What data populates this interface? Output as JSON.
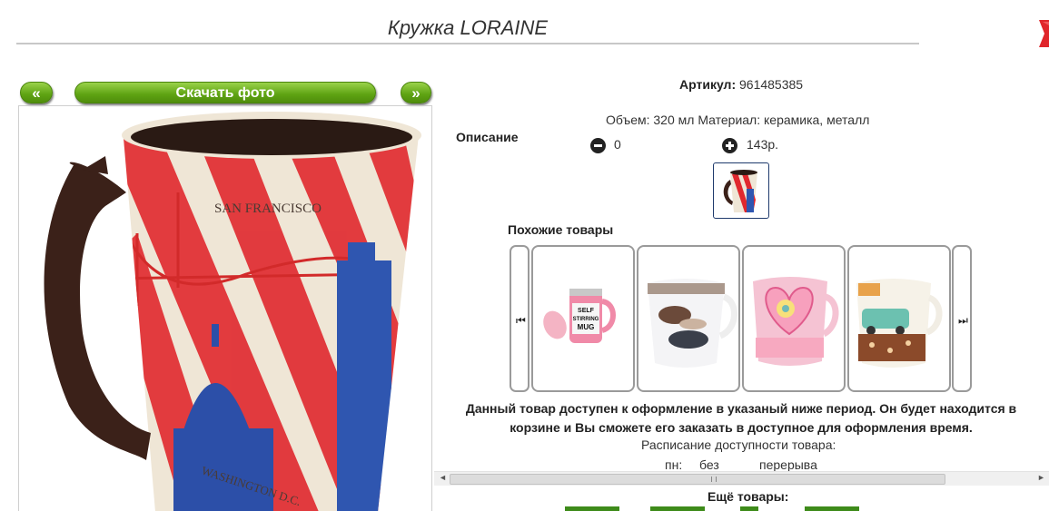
{
  "product": {
    "title": "Кружка LORAINE",
    "sku_label": "Артикул:",
    "sku_value": "961485385",
    "description_label": "Описание",
    "description_text": "Объем: 320 мл Материал: керамика, металл",
    "qty_value": "0",
    "price": "143р."
  },
  "photo_nav": {
    "prev_label": "«",
    "download_label": "Скачать фото",
    "next_label": "»"
  },
  "photo_text": {
    "city_top": "SAN FRANCISCO",
    "city_bottom": "WASHINGTON D.C."
  },
  "similar": {
    "title": "Похожие товары",
    "prev_icon": "skip-back-icon",
    "next_icon": "skip-forward-icon",
    "items": [
      {
        "image_text": "SELF STIRRING MUG"
      },
      {
        "image_text": ""
      },
      {
        "image_text": ""
      },
      {
        "image_text": ""
      }
    ]
  },
  "availability": {
    "notice": "Данный товар доступен к оформление в указаный ниже период. Он будет находится в корзине и Вы сможете его заказать в доступное для оформления время.",
    "schedule_title": "Расписание доступности товара:",
    "schedule_day": "пн:",
    "schedule_from": "без",
    "schedule_to": "перерыва"
  },
  "more": {
    "title": "Ещё товары:"
  },
  "colors": {
    "button_green": "#5ea312",
    "close_red": "#e0262b"
  }
}
